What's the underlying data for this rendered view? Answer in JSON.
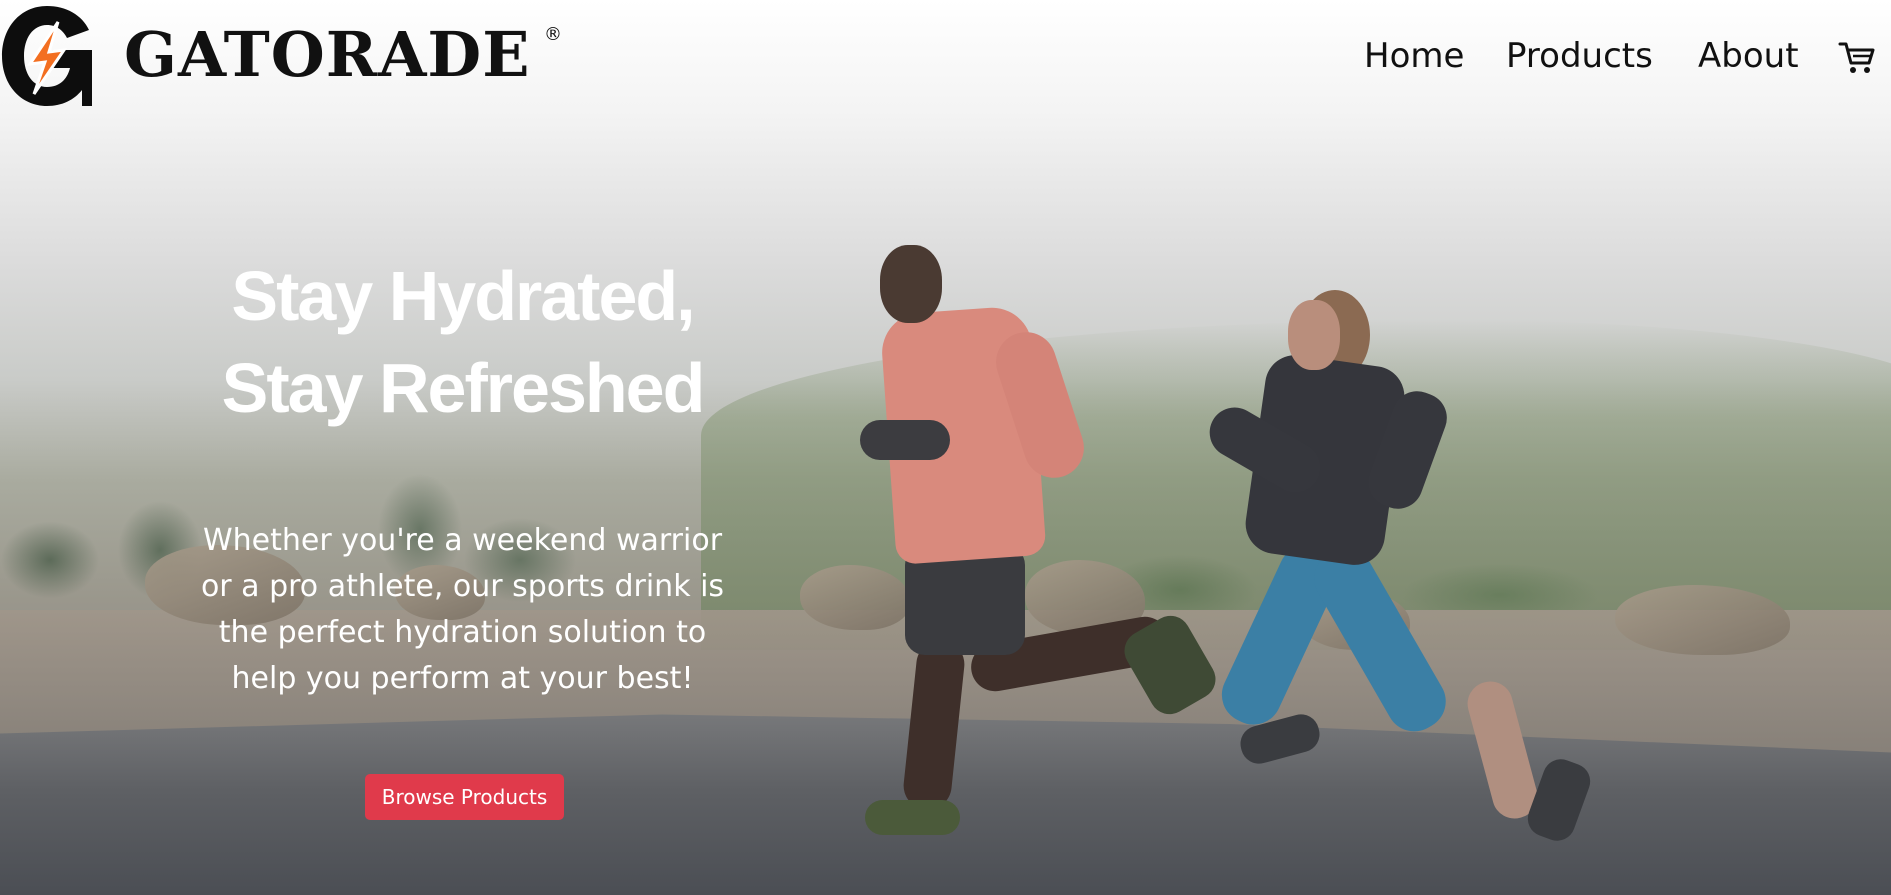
{
  "brand": {
    "name": "GATORADE",
    "registered_mark": "®",
    "logo_icon": "gatorade-g-bolt-logo"
  },
  "nav": {
    "items": [
      {
        "label": "Home"
      },
      {
        "label": "Products"
      },
      {
        "label": "About"
      }
    ],
    "cart_icon": "shopping-cart-icon"
  },
  "hero": {
    "title_line1": "Stay Hydrated,",
    "title_line2": "Stay Refreshed",
    "body": "Whether you're a weekend warrior or a pro athlete, our sports drink is the perfect hydration solution to help you perform at your best!",
    "cta_label": "Browse Products"
  },
  "colors": {
    "cta_background": "#e03a4b",
    "logo_orange": "#f36f21",
    "text_dark": "#111111",
    "text_light": "#ffffff"
  }
}
